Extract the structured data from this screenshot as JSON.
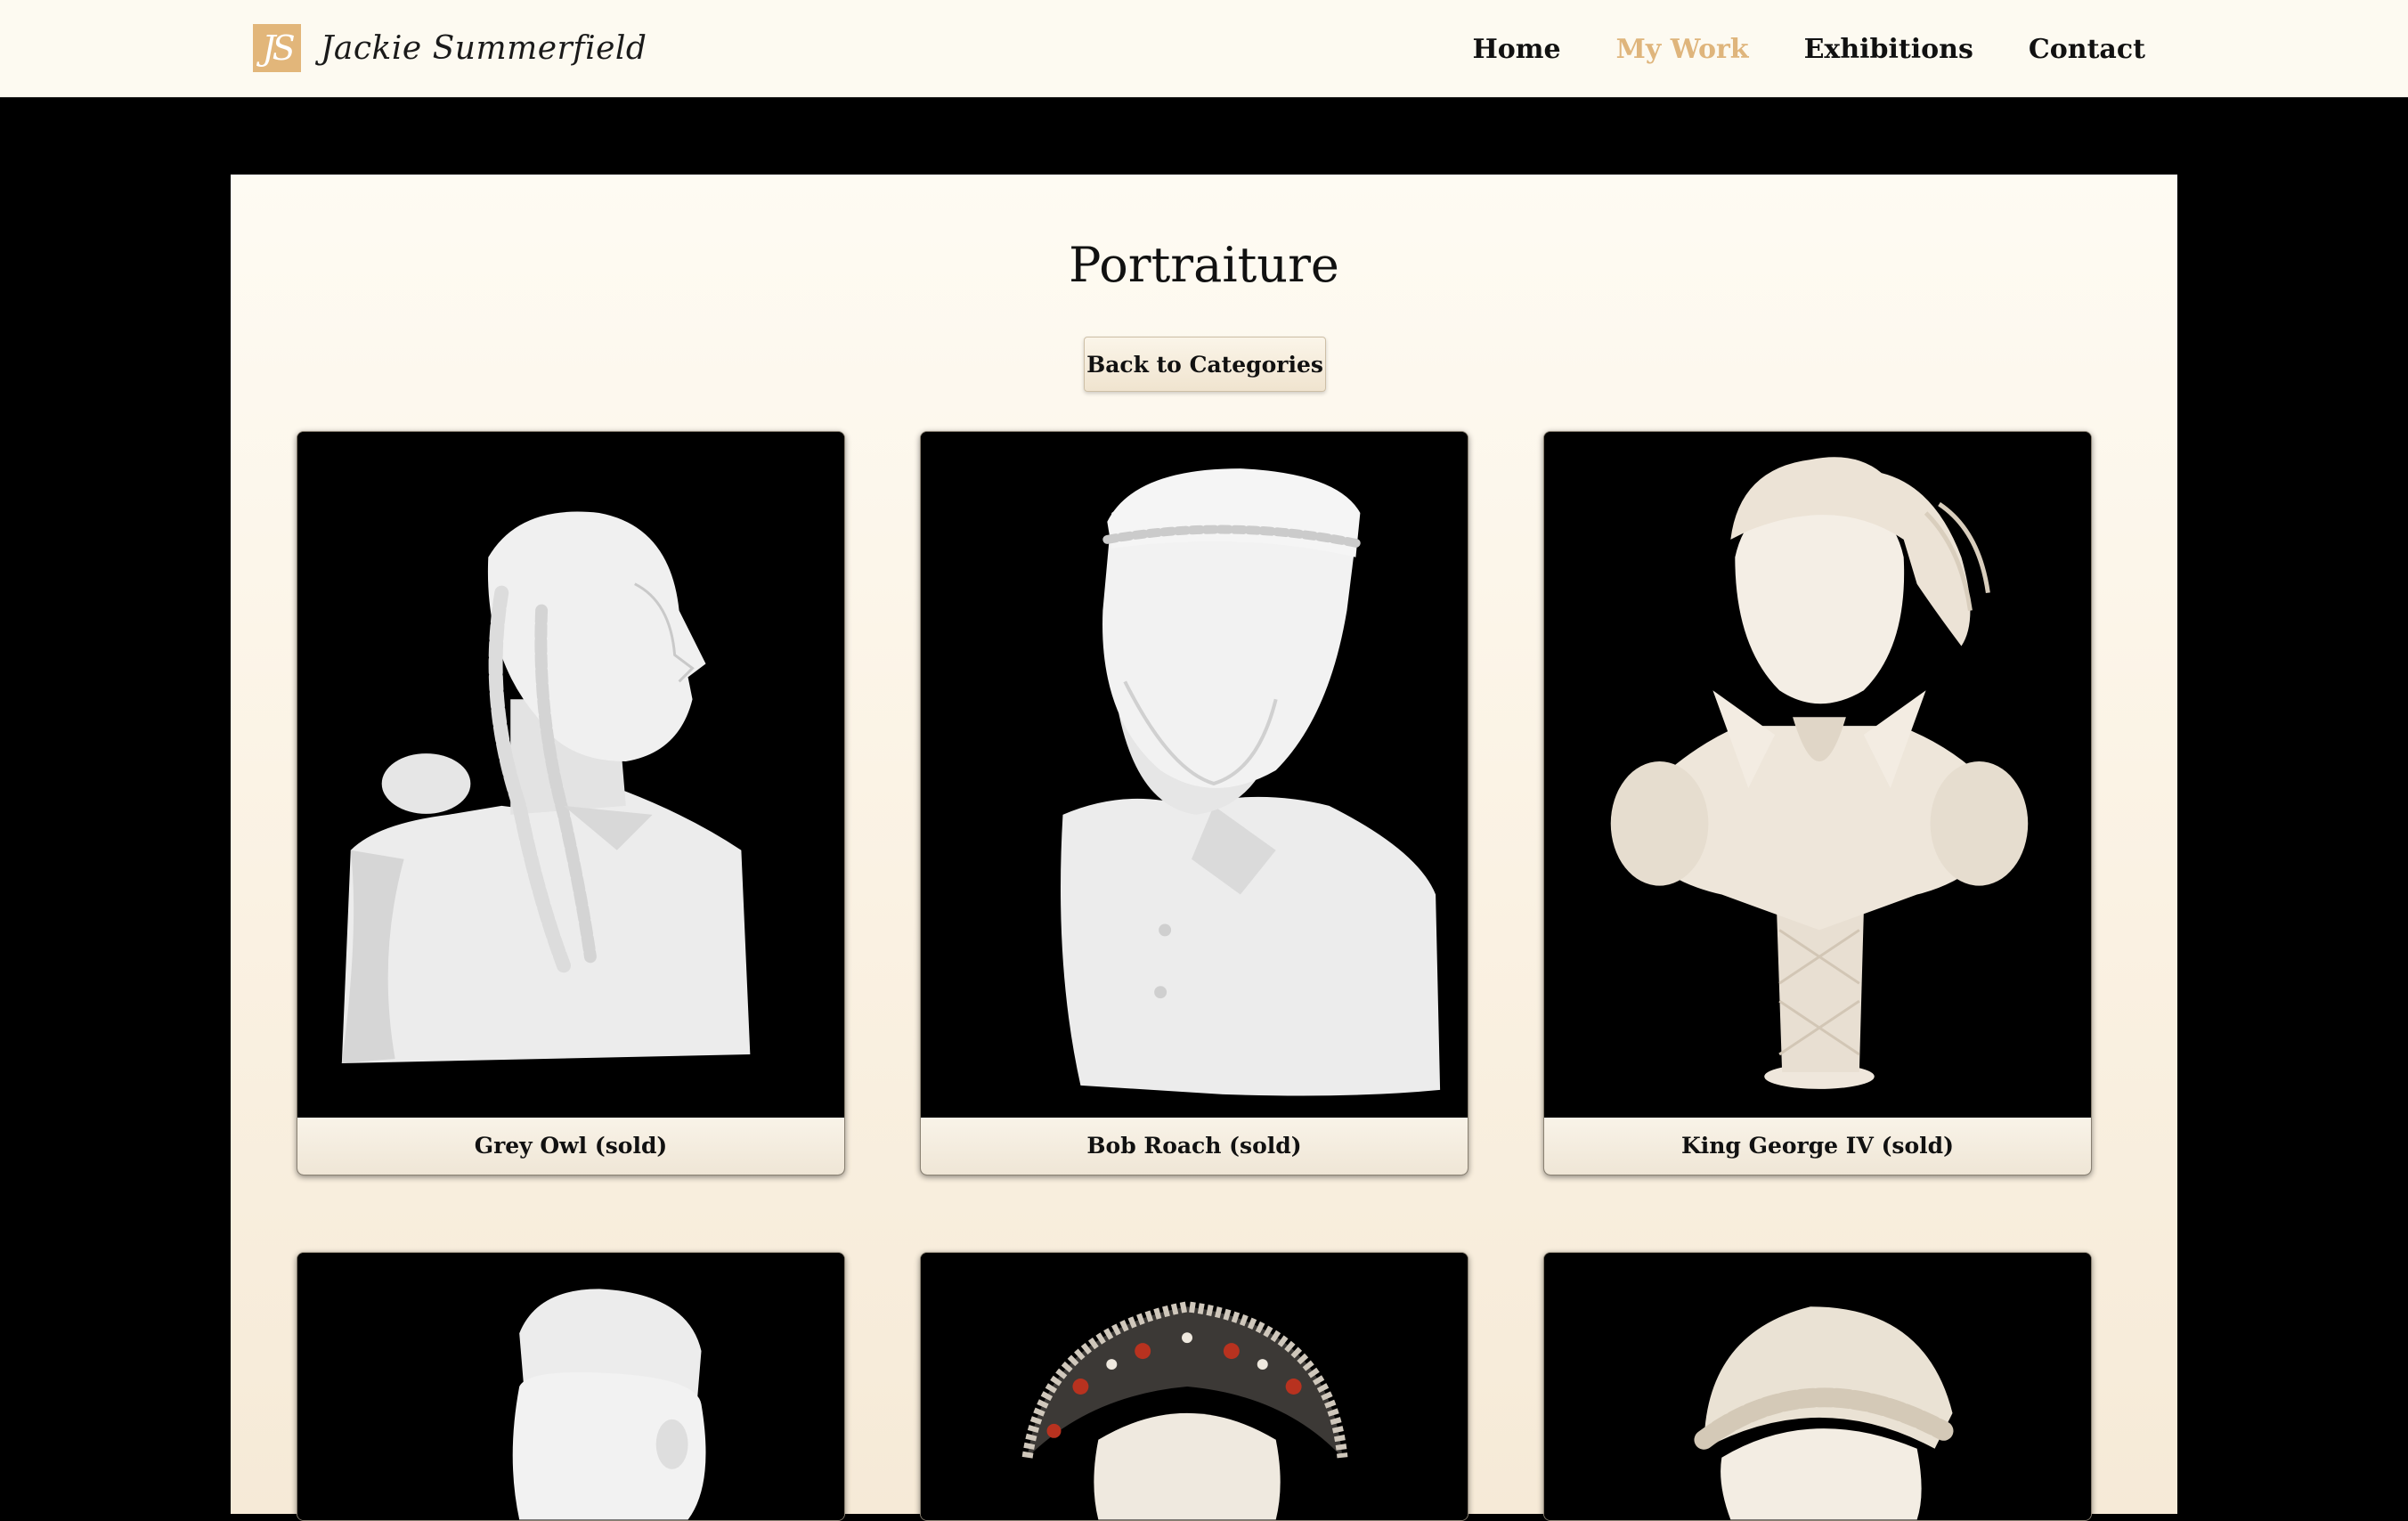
{
  "header": {
    "logo_mark": "JS",
    "site_name": "Jackie Summerfield",
    "nav": [
      {
        "label": "Home",
        "active": false
      },
      {
        "label": "My Work",
        "active": true
      },
      {
        "label": "Exhibitions",
        "active": false
      },
      {
        "label": "Contact",
        "active": false
      }
    ]
  },
  "page": {
    "title": "Portraiture",
    "back_button": "Back to Categories"
  },
  "gallery": [
    {
      "title": "Grey Owl (sold)",
      "image": "sculpture-bust-braided-hair"
    },
    {
      "title": "Bob Roach (sold)",
      "image": "sculpture-bust-bearded-man-cap"
    },
    {
      "title": "King George IV (sold)",
      "image": "sculpture-bust-king-george"
    },
    {
      "title": "",
      "image": "sculpture-bust-man-cap"
    },
    {
      "title": "",
      "image": "sculpture-bust-tudor-hat"
    },
    {
      "title": "",
      "image": "sculpture-bust-braided-headdress"
    }
  ],
  "colors": {
    "accent": "#dfb57c",
    "logo_bg": "#e2b67a",
    "header_bg": "#fdfaf1",
    "page_bg": "#000000"
  }
}
